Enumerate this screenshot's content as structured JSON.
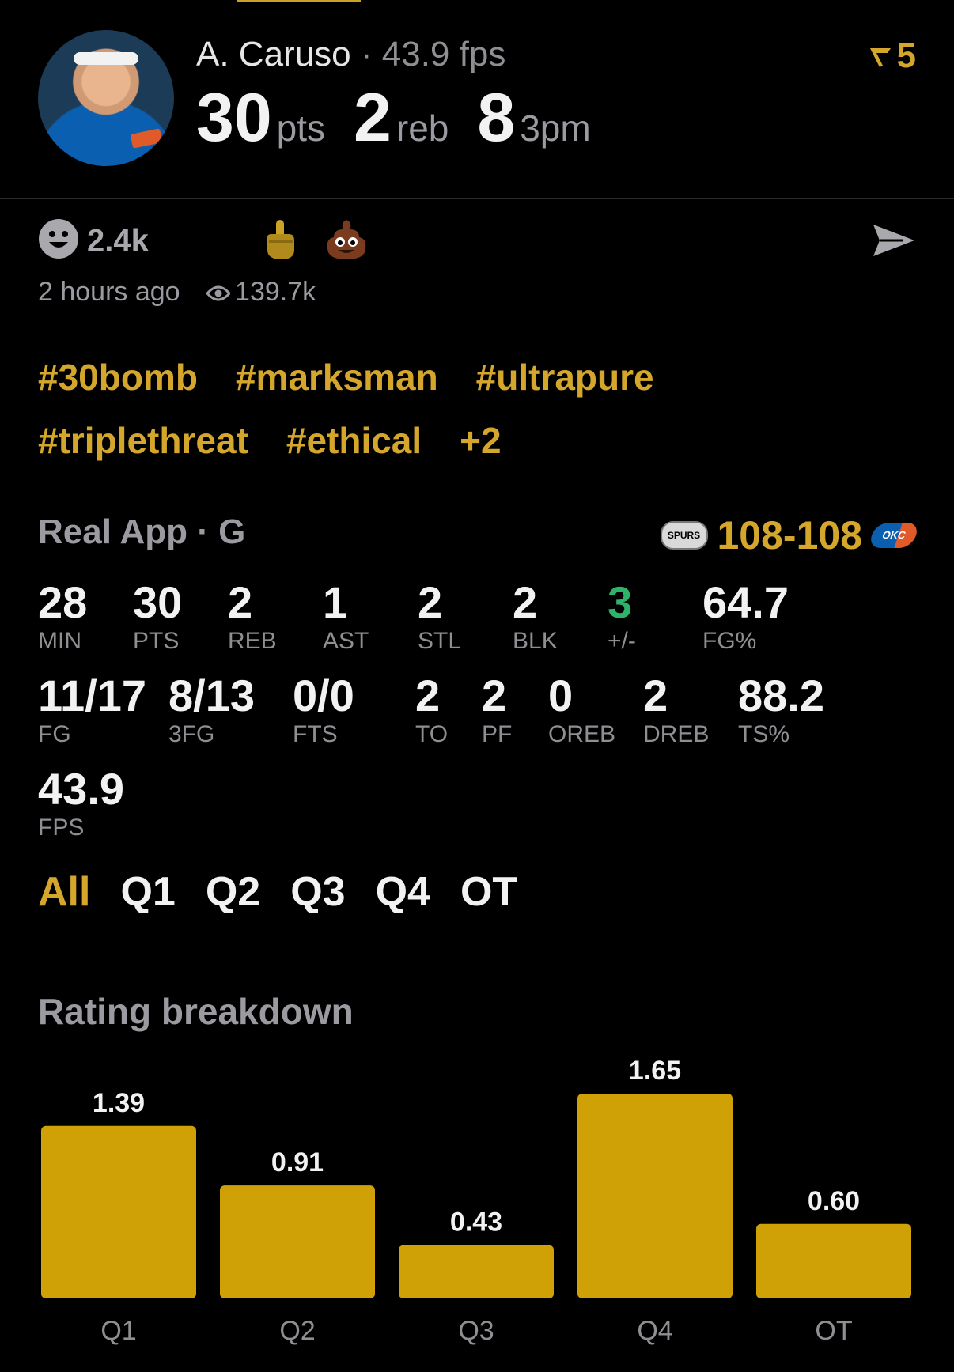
{
  "player": {
    "name": "A. Caruso",
    "separator": "·",
    "fps_label": "43.9 fps",
    "headline": [
      {
        "value": "30",
        "unit": "pts"
      },
      {
        "value": "2",
        "unit": "reb"
      },
      {
        "value": "8",
        "unit": "3pm"
      }
    ],
    "rank_badge": "5"
  },
  "reactions": {
    "count": "2.4k",
    "emoji": [
      "middle-finger",
      "poop"
    ],
    "time": "2 hours ago",
    "views": "139.7k"
  },
  "tags": [
    [
      "#30bomb",
      "#marksman",
      "#ultrapure"
    ],
    [
      "#triplethreat",
      "#ethical",
      "+2"
    ]
  ],
  "game": {
    "title": "Real App · G",
    "score": "108-108",
    "away_logo": "SPURS",
    "home_logo": "OKC"
  },
  "stats": {
    "row1": [
      {
        "value": "28",
        "label": "MIN"
      },
      {
        "value": "30",
        "label": "PTS"
      },
      {
        "value": "2",
        "label": "REB"
      },
      {
        "value": "1",
        "label": "AST"
      },
      {
        "value": "2",
        "label": "STL"
      },
      {
        "value": "2",
        "label": "BLK"
      },
      {
        "value": "3",
        "label": "+/-"
      },
      {
        "value": "64.7",
        "label": "FG%"
      }
    ],
    "row2": [
      {
        "value": "11/17",
        "label": "FG"
      },
      {
        "value": "8/13",
        "label": "3FG"
      },
      {
        "value": "0/0",
        "label": "FTS"
      },
      {
        "value": "2",
        "label": "TO"
      },
      {
        "value": "2",
        "label": "PF"
      },
      {
        "value": "0",
        "label": "OREB"
      },
      {
        "value": "2",
        "label": "DREB"
      },
      {
        "value": "88.2",
        "label": "TS%"
      }
    ],
    "row3": [
      {
        "value": "43.9",
        "label": "FPS"
      }
    ]
  },
  "quarter_tabs": [
    "All",
    "Q1",
    "Q2",
    "Q3",
    "Q4",
    "OT"
  ],
  "active_tab": "All",
  "rating_title": "Rating breakdown",
  "colors": {
    "accent": "#d4a72c",
    "bar": "#cfa106",
    "positive": "#2db36a",
    "muted": "#9a9aa0"
  },
  "chart_data": {
    "type": "bar",
    "categories": [
      "Q1",
      "Q2",
      "Q3",
      "Q4",
      "OT"
    ],
    "values": [
      1.39,
      0.91,
      0.43,
      1.65,
      0.6
    ],
    "value_labels": [
      "1.39",
      "0.91",
      "0.43",
      "1.65",
      "0.60"
    ],
    "title": "Rating breakdown",
    "xlabel": "",
    "ylabel": "",
    "grid": false
  }
}
